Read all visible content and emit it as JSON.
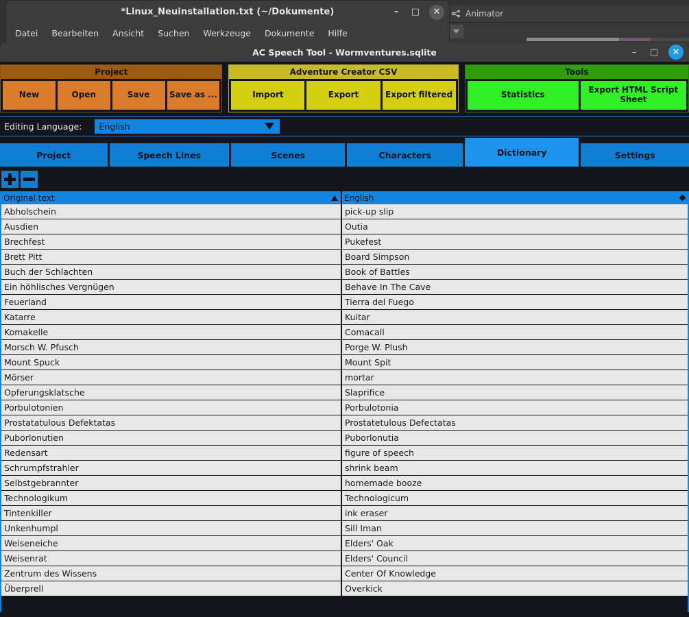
{
  "desktop": {
    "unity": {
      "tab_label": "Animator",
      "icon": "animator-icon"
    }
  },
  "gedit": {
    "title": "*Linux_Neuinstallation.txt (~/Dokumente)",
    "window_buttons": {
      "minimize": "–",
      "maximize": "□",
      "close": "✕"
    },
    "menu": [
      "Datei",
      "Bearbeiten",
      "Ansicht",
      "Suchen",
      "Werkzeuge",
      "Dokumente",
      "Hilfe"
    ]
  },
  "app": {
    "title": "AC Speech Tool - Wormventures.sqlite",
    "window_buttons": {
      "minimize": "–",
      "maximize": "□",
      "close": "✕"
    },
    "toolbar": {
      "groups": [
        {
          "name": "Project",
          "header_color": "#9c5b10",
          "button_color": "#da7c2a",
          "buttons": [
            "New",
            "Open",
            "Save",
            "Save as ..."
          ]
        },
        {
          "name": "Adventure Creator CSV",
          "header_color": "#c9bb25",
          "button_color": "#d4d011",
          "buttons": [
            "Import",
            "Export",
            "Export filtered"
          ]
        },
        {
          "name": "Tools",
          "header_color": "#2f9e0e",
          "button_color": "#2ff024",
          "buttons": [
            "Statistics",
            "Export HTML Script Sheet"
          ]
        }
      ]
    },
    "language": {
      "label": "Editing Language:",
      "value": "English"
    },
    "tabs": [
      {
        "label": "Project",
        "active": false
      },
      {
        "label": "Speech Lines",
        "active": false
      },
      {
        "label": "Scenes",
        "active": false
      },
      {
        "label": "Characters",
        "active": false
      },
      {
        "label": "Dictionary",
        "active": true
      },
      {
        "label": "Settings",
        "active": false
      }
    ],
    "row_tools": {
      "add": "add-row-button",
      "remove": "remove-row-button"
    },
    "table": {
      "columns": [
        {
          "label": "Original text",
          "sort": "asc"
        },
        {
          "label": "English",
          "sort": "none"
        }
      ],
      "rows": [
        [
          "Abholschein",
          "pick-up slip"
        ],
        [
          "Ausdien",
          "Outia"
        ],
        [
          "Brechfest",
          "Pukefest"
        ],
        [
          "Brett Pitt",
          "Board Simpson"
        ],
        [
          "Buch der Schlachten",
          "Book of Battles"
        ],
        [
          "Ein höhlisches Vergnügen",
          "Behave In The Cave"
        ],
        [
          "Feuerland",
          "Tierra del Fuego"
        ],
        [
          "Katarre",
          "Kuitar"
        ],
        [
          "Komakelle",
          "Comacall"
        ],
        [
          "Morsch W. Pfusch",
          "Porge W. Plush"
        ],
        [
          "Mount Spuck",
          "Mount Spit"
        ],
        [
          "Mörser",
          "mortar"
        ],
        [
          "Opferungsklatsche",
          "Slaprifice"
        ],
        [
          "Porbulotonien",
          "Porbulotonia"
        ],
        [
          "Prostatatulous Defektatas",
          "Prostatetulous Defectatas"
        ],
        [
          "Puborlonutien",
          "Puborlonutia"
        ],
        [
          "Redensart",
          "figure of speech"
        ],
        [
          "Schrumpfstrahler",
          "shrink beam"
        ],
        [
          "Selbstgebrannter",
          "homemade booze"
        ],
        [
          "Technologikum",
          "Technologicum"
        ],
        [
          "Tintenkiller",
          "ink eraser"
        ],
        [
          "Unkenhumpl",
          "Sill Iman"
        ],
        [
          "Weiseneiche",
          "Elders' Oak"
        ],
        [
          "Weisenrat",
          "Elders' Council"
        ],
        [
          "Zentrum des Wissens",
          "Center Of Knowledge"
        ],
        [
          "Überprell",
          "Overkick"
        ]
      ]
    }
  },
  "colors": {
    "accent_blue": "#1186e0",
    "tab_blue": "#0f7fd4",
    "tab_active_blue": "#1d93ec",
    "window_bg": "#12151c",
    "row_bg": "#e8e8e8"
  }
}
